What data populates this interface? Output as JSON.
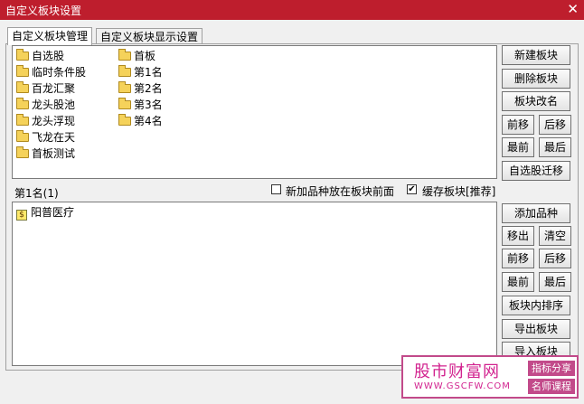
{
  "window": {
    "title": "自定义板块设置",
    "close_glyph": "✕"
  },
  "tabs": [
    {
      "label": "自定义板块管理",
      "active": true
    },
    {
      "label": "自定义板块显示设置",
      "active": false
    }
  ],
  "block_list": {
    "column1": [
      "自选股",
      "临时条件股",
      "百龙汇聚",
      "龙头股池",
      "龙头浮现",
      "飞龙在天",
      "首板测试"
    ],
    "column2": [
      "首板",
      "第1名",
      "第2名",
      "第3名",
      "第4名"
    ],
    "folder_icon": "folder-icon"
  },
  "block_buttons": {
    "new": "新建板块",
    "delete": "删除板块",
    "rename": "板块改名",
    "move_up": "前移",
    "move_down": "后移",
    "move_first": "最前",
    "move_last": "最后",
    "migrate_watchlist": "自选股迁移"
  },
  "selected_block": {
    "label": "第1名(1)",
    "option_new_front": {
      "label": "新加品种放在板块前面",
      "checked": false
    },
    "option_cache": {
      "label": "缓存板块[推荐]",
      "checked": true
    },
    "stocks": [
      {
        "name": "阳普医疗",
        "icon": "stock-icon"
      }
    ]
  },
  "stock_buttons": {
    "add": "添加品种",
    "remove": "移出",
    "clear": "清空",
    "move_up": "前移",
    "move_down": "后移",
    "move_first": "最前",
    "move_last": "最后",
    "sort": "板块内排序",
    "export": "导出板块",
    "import": "导入板块"
  },
  "watermark": {
    "main": "股市财富网",
    "url": "WWW.GSCFW.COM",
    "tag1": "指标分享",
    "tag2": "名师课程"
  },
  "colors": {
    "titlebar": "#be1e2d",
    "watermark": "#d2238f"
  }
}
